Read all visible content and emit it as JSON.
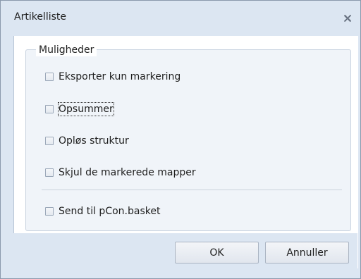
{
  "window": {
    "title": "Artikelliste",
    "close_icon": "close-x-icon"
  },
  "options_group": {
    "legend": "Muligheder",
    "checkboxes": [
      {
        "label": "Eksporter kun markering",
        "checked": false
      },
      {
        "label": "Opsummer",
        "checked": false,
        "focused": true
      },
      {
        "label": "Opløs struktur",
        "checked": false
      },
      {
        "label": "Skjul de markerede mapper",
        "checked": false
      },
      {
        "label": "Send til pCon.basket",
        "checked": false
      }
    ]
  },
  "buttons": {
    "ok_label": "OK",
    "cancel_label": "Annuller"
  },
  "colors": {
    "chrome": "#dce6f2",
    "border": "#8a99ad",
    "content_bg": "#ffffff"
  }
}
